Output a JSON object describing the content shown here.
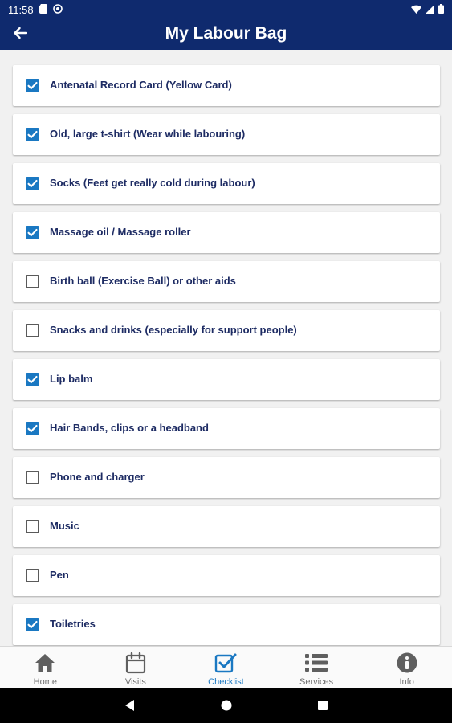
{
  "status_bar": {
    "time": "11:58"
  },
  "app_bar": {
    "title": "My Labour Bag"
  },
  "checklist": [
    {
      "label": "Antenatal Record Card (Yellow Card)",
      "checked": true
    },
    {
      "label": "Old, large t-shirt (Wear while labouring)",
      "checked": true
    },
    {
      "label": "Socks (Feet get really cold during labour)",
      "checked": true
    },
    {
      "label": "Massage oil / Massage roller",
      "checked": true
    },
    {
      "label": "Birth ball (Exercise Ball) or other aids",
      "checked": false
    },
    {
      "label": "Snacks and drinks (especially for support people)",
      "checked": false
    },
    {
      "label": "Lip balm",
      "checked": true
    },
    {
      "label": "Hair Bands, clips or a headband",
      "checked": true
    },
    {
      "label": "Phone and charger",
      "checked": false
    },
    {
      "label": "Music",
      "checked": false
    },
    {
      "label": "Pen",
      "checked": false
    },
    {
      "label": "Toiletries",
      "checked": true
    }
  ],
  "bottom_nav": [
    {
      "label": "Home",
      "icon": "home-icon",
      "active": false
    },
    {
      "label": "Visits",
      "icon": "calendar-icon",
      "active": false
    },
    {
      "label": "Checklist",
      "icon": "checklist-icon",
      "active": true
    },
    {
      "label": "Services",
      "icon": "list-icon",
      "active": false
    },
    {
      "label": "Info",
      "icon": "info-icon",
      "active": false
    }
  ],
  "colors": {
    "primary": "#0f2a6e",
    "accent": "#1a78c2",
    "item_text": "#1d2b63",
    "inactive_nav": "#6f6f6f"
  }
}
